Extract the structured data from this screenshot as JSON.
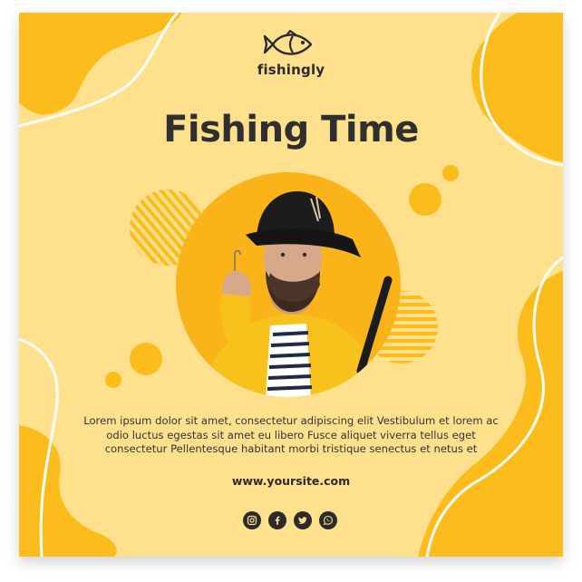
{
  "brand": {
    "name": "fishingly",
    "logo_icon": "fish-icon"
  },
  "title": "Fishing Time",
  "body_text": "Lorem ipsum dolor sit amet, consectetur adipiscing elit Vestibulum et lorem ac odio luctus egestas sit amet eu libero Fusce aliquet viverra tellus eget consectetur Pellentesque habitant morbi tristique senectus et netus et",
  "website": "www.yoursite.com",
  "socials": [
    "instagram-icon",
    "facebook-icon",
    "twitter-icon",
    "whatsapp-icon"
  ],
  "colors": {
    "background": "#ffe08d",
    "accent": "#fcbc1c",
    "text": "#2f2f2f"
  }
}
